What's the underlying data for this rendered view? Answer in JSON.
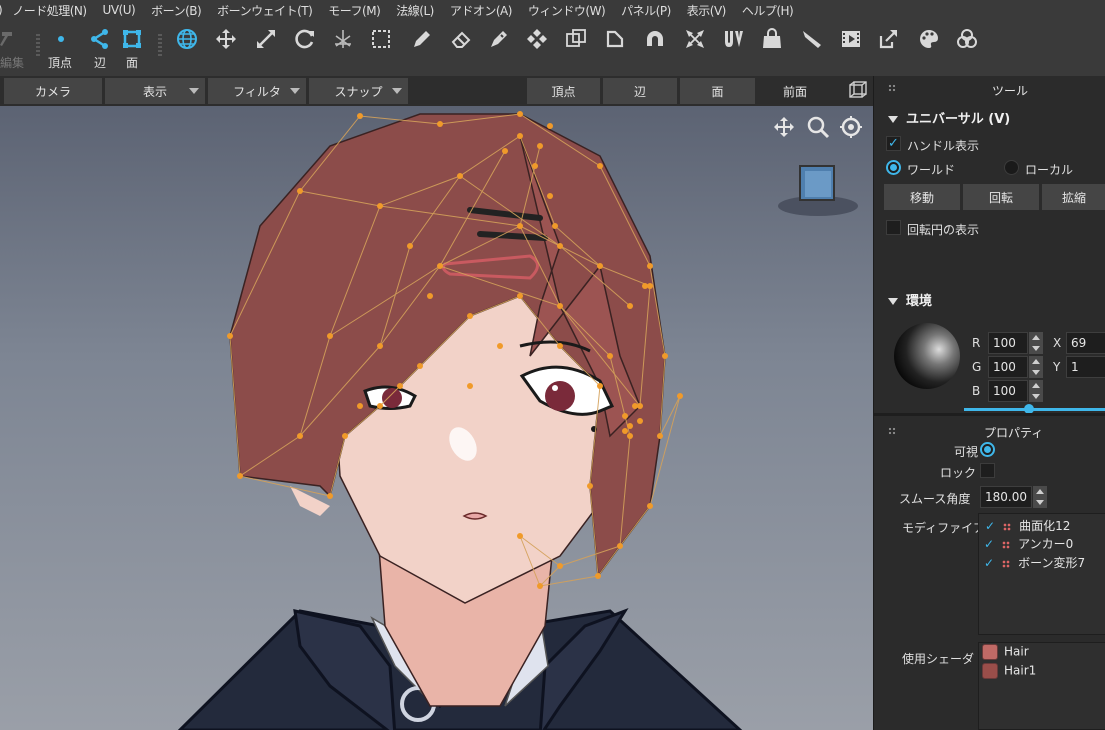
{
  "menu": {
    "items": [
      "ノード処理(N)",
      "UV(U)",
      "ボーン(B)",
      "ボーンウェイト(T)",
      "モーフ(M)",
      "法線(L)",
      "アドオン(A)",
      "ウィンドウ(W)",
      "パネル(P)",
      "表示(V)",
      "ヘルプ(H)"
    ],
    "edge_fragment": ")"
  },
  "toolbar": {
    "edit_label": "編集",
    "vertex_label": "頂点",
    "edge_label": "辺",
    "face_label": "面",
    "icons": [
      "globe-icon",
      "move-icon",
      "scale-icon",
      "rotate-icon",
      "transform-gizmo-icon",
      "rect-select-icon",
      "pencil-icon",
      "eraser-icon",
      "paint-pen-icon",
      "four-diamond-icon",
      "uv-cube-icon",
      "d-shape-icon",
      "magnet-icon",
      "corners-icon",
      "uv-icon",
      "bag-icon",
      "knife-icon",
      "film-icon",
      "export-icon",
      "palette-icon",
      "circles-icon"
    ],
    "accent": "#3fb7ea"
  },
  "viewport_bar": {
    "camera": "カメラ",
    "display": "表示",
    "filter": "フィルタ",
    "snap": "スナップ",
    "vertex": "頂点",
    "edge": "辺",
    "face": "面",
    "view": "前面"
  },
  "panel": {
    "tool_title": "ツール",
    "universal_section": "ユニバーサル (V)",
    "handle_display": "ハンドル表示",
    "world": "ワールド",
    "local": "ローカル",
    "move": "移動",
    "rotate": "回転",
    "scale": "拡縮",
    "rotation_circle": "回転円の表示",
    "environment_section": "環境",
    "r_label": "R",
    "r_value": "100",
    "g_label": "G",
    "g_value": "100",
    "b_label": "B",
    "b_value": "100",
    "x_label": "X",
    "x_value": "69",
    "y_label": "Y",
    "y_value": "1",
    "properties_title": "プロパティ",
    "visible_label": "可視",
    "lock_label": "ロック",
    "smooth_angle_label": "スムース角度",
    "smooth_angle_value": "180.00",
    "modifier_label": "モディファイア",
    "modifiers": [
      "曲面化12",
      "アンカー0",
      "ボーン変形7"
    ],
    "shader_label": "使用シェーダ",
    "shaders": [
      {
        "name": "Hair",
        "color": "#e07a6e"
      },
      {
        "name": "Hair1",
        "color": "#b85a52"
      }
    ]
  },
  "colors": {
    "hair": "#8c4c4a",
    "skin": "#f2d2c8",
    "mesh_vertex": "#f09a2a",
    "jacket": "#262c40"
  }
}
